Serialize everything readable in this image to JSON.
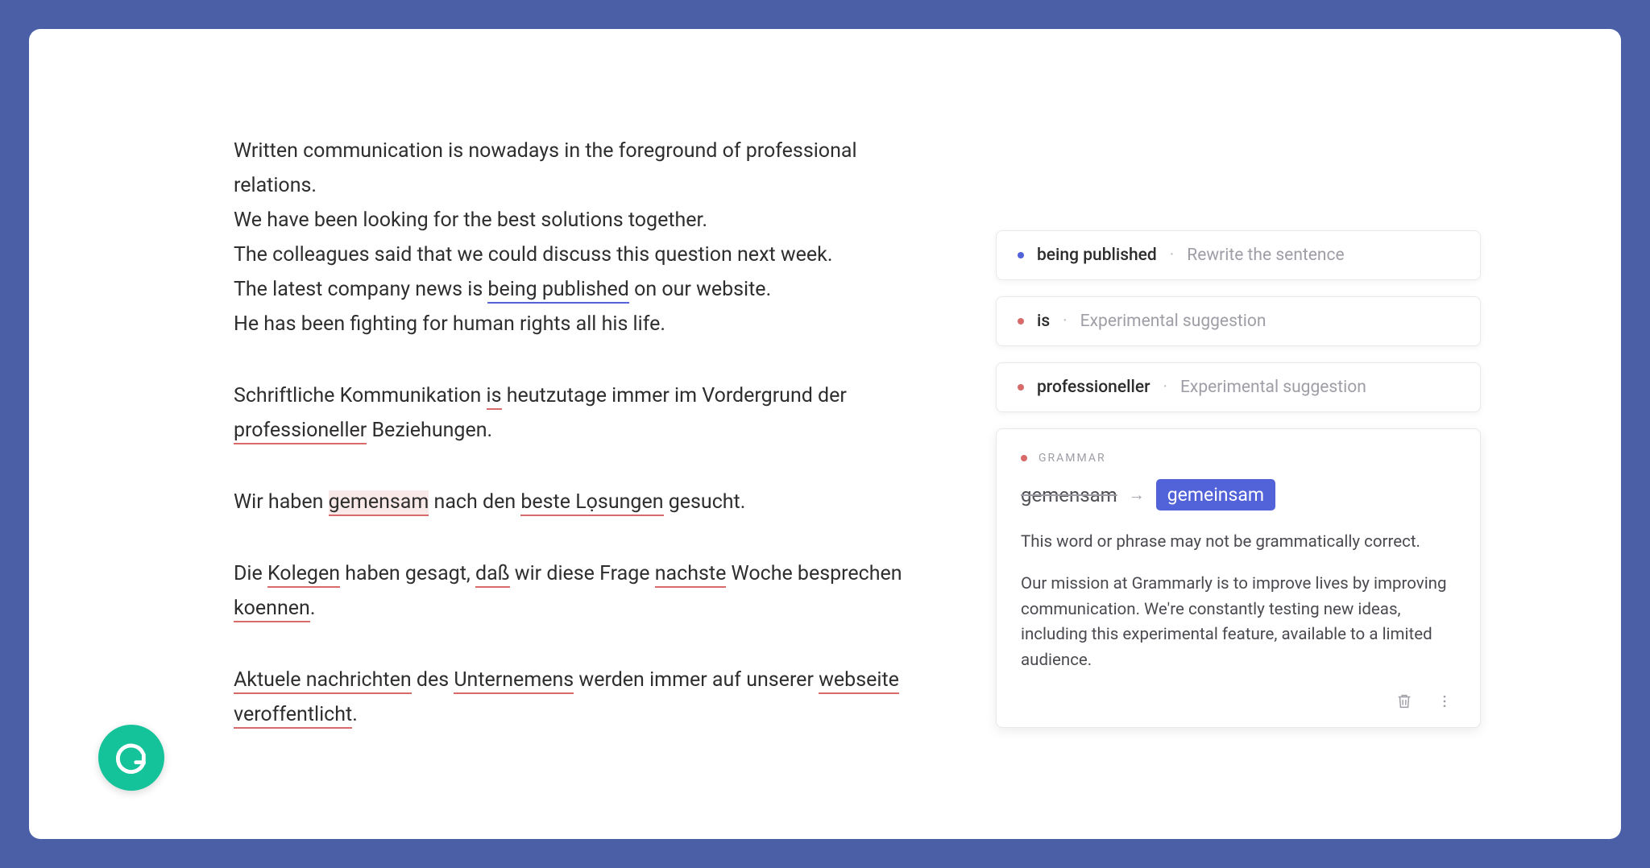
{
  "editor": {
    "en": {
      "line1_a": "Written communication is nowadays in the foreground of professional",
      "line1_b": "relations.",
      "line2": "We have been looking for the best solutions together.",
      "line3": "The colleagues said that we could discuss this question next week.",
      "line4_a": "The latest company news is ",
      "line4_u": "being published",
      "line4_b": " on our website.",
      "line5": "He has been fighting for human rights all his life."
    },
    "de1": {
      "a": "Schriftliche Kommunikation ",
      "u1": "is",
      "b": " heutzutage immer im Vordergrund der ",
      "u2": "professioneller",
      "c": " Beziehungen."
    },
    "de2": {
      "a": "Wir haben ",
      "u1": "gemensam",
      "b": " nach den ",
      "u2": "beste Lọsungen",
      "c": " gesucht."
    },
    "de3": {
      "a": "Die ",
      "u1": "Kolegen",
      "b": " haben gesagt, ",
      "u2": "daß",
      "c": " wir diese Frage  ",
      "u3": "nachste",
      "d": " Woche besprechen ",
      "u4": "koennen",
      "e": "."
    },
    "de4": {
      "u1": "Aktuele nachrichten",
      "a": " des ",
      "u2": "Unternemens",
      "b": " werden immer auf unserer ",
      "u3": "webseite veroffentlicht",
      "c": "."
    }
  },
  "cards": [
    {
      "color": "blue",
      "word": "being published",
      "hint": "Rewrite the sentence"
    },
    {
      "color": "red",
      "word": "is",
      "hint": "Experimental suggestion"
    },
    {
      "color": "red",
      "word": "professioneller",
      "hint": "Experimental suggestion"
    }
  ],
  "expanded": {
    "category": "GRAMMAR",
    "from": "gemensam",
    "to": "gemeinsam",
    "desc1": "This word or phrase may not be grammatically correct.",
    "desc2": "Our mission at Grammarly is to improve lives by improving communication. We're constantly testing new ideas, including this experimental feature, available to a limited audience."
  },
  "sep": "·"
}
